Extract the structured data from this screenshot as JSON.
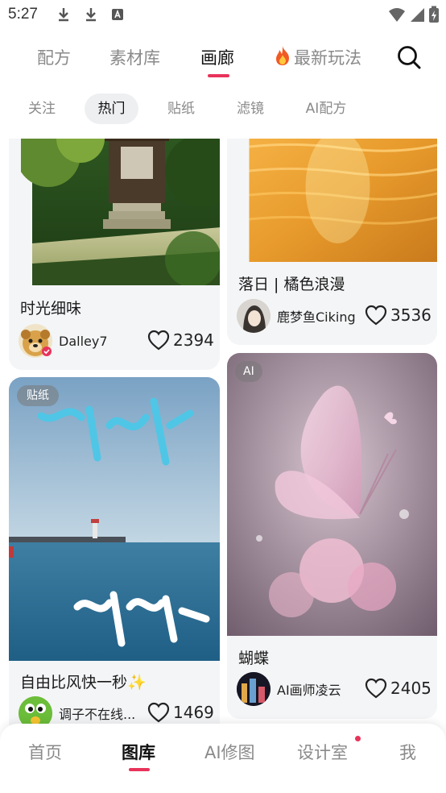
{
  "status_bar": {
    "time": "5:27"
  },
  "top_tabs": [
    {
      "label": "配方"
    },
    {
      "label": "素材库"
    },
    {
      "label": "画廊"
    },
    {
      "label": "最新玩法",
      "icon": "fire-icon"
    }
  ],
  "active_top_tab": "画廊",
  "sub_tabs": [
    {
      "label": "关注"
    },
    {
      "label": "热门"
    },
    {
      "label": "贴纸"
    },
    {
      "label": "滤镜"
    },
    {
      "label": "AI配方"
    }
  ],
  "active_sub_tab": "热门",
  "feed": {
    "left": [
      {
        "title": "时光细味",
        "author": "Dalley7",
        "likes": "2394",
        "verified": true
      },
      {
        "badge": "贴纸",
        "title": "自由比风快一秒",
        "title_emoji": "✨",
        "author": "调子不在线...",
        "likes": "1469"
      }
    ],
    "right": [
      {
        "title": "落日 | 橘色浪漫",
        "author": "鹿梦鱼Ciking",
        "likes": "3536"
      },
      {
        "badge": "AI",
        "title": "蝴蝶",
        "author": "AI画师凌云",
        "likes": "2405"
      }
    ]
  },
  "bottom_nav": [
    {
      "label": "首页"
    },
    {
      "label": "图库"
    },
    {
      "label": "AI修图"
    },
    {
      "label": "设计室",
      "has_notification_dot": true
    },
    {
      "label": "我"
    }
  ],
  "active_bottom_nav": "图库",
  "colors": {
    "accent": "#e8335a",
    "card_bg": "#f4f5f7",
    "inactive_text": "#8a8a8a"
  }
}
